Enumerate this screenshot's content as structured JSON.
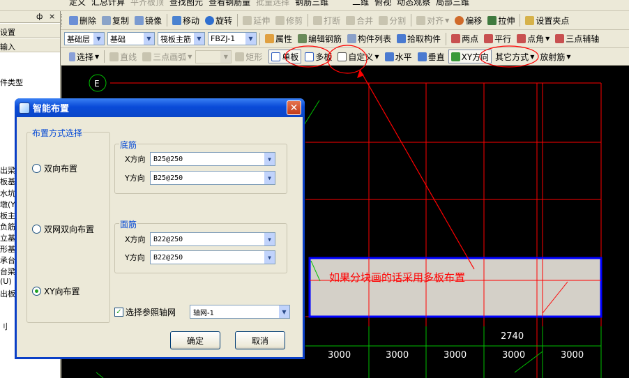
{
  "toolbar0": {
    "items": [
      "定义",
      "汇总计算",
      "平齐板顶",
      "查找图元",
      "查看钢筋量",
      "批量选择",
      "钢筋三维",
      "二维",
      "俯视",
      "动态观察",
      "局部三维"
    ]
  },
  "toolbar1": {
    "items": [
      "删除",
      "复制",
      "镜像",
      "移动",
      "旋转",
      "延伸",
      "修剪",
      "打断",
      "合并",
      "分割",
      "对齐",
      "偏移",
      "拉伸",
      "设置夹点"
    ]
  },
  "toolbar2": {
    "floor": "基础层",
    "category": "基础",
    "type": "筏板主筋",
    "element": "FBZJ-1",
    "items": [
      "属性",
      "编辑钢筋",
      "构件列表",
      "拾取构件",
      "两点",
      "平行",
      "点角",
      "三点辅轴"
    ]
  },
  "toolbar3": {
    "items": [
      "选择",
      "直线",
      "三点画弧",
      "矩形",
      "单板",
      "多板",
      "自定义",
      "水平",
      "垂直",
      "XY方向",
      "其它方式",
      "放射筋"
    ]
  },
  "left_panel": {
    "pin": "ф",
    "close": "×",
    "items": [
      "设置",
      "输入",
      "件类型",
      "出梁",
      "板基",
      "水坑",
      "墩(Y",
      "板主",
      "负筋",
      "立基",
      "形基",
      "承台",
      "台梁",
      "(U)",
      "出板",
      "刂"
    ]
  },
  "canvas": {
    "axis_label": "E",
    "dims": [
      "3000",
      "3000",
      "3000",
      "3000",
      "3000"
    ],
    "dim_2740": "2740",
    "note": "如果分块画的话采用多板布置"
  },
  "dialog": {
    "title": "智能布置",
    "layout_group": "布置方式选择",
    "options": [
      "双向布置",
      "双网双向布置",
      "XY向布置"
    ],
    "selected_option": "XY向布置",
    "bottom_group": "底筋",
    "top_group": "面筋",
    "x_label": "X方向",
    "y_label": "Y方向",
    "bottom_x": "B25@250",
    "bottom_y": "B25@250",
    "top_x": "B22@250",
    "top_y": "B22@250",
    "ref_axis_label": "选择参照轴网",
    "ref_axis_checked": true,
    "ref_axis_value": "轴网-1",
    "ok": "确定",
    "cancel": "取消"
  },
  "colors": {
    "titlebar": "#0a4bd8",
    "annotation": "#e00000",
    "grid": "#ff0000",
    "slab_fill": "#d4d0c8",
    "slab_border": "#0000ff"
  }
}
